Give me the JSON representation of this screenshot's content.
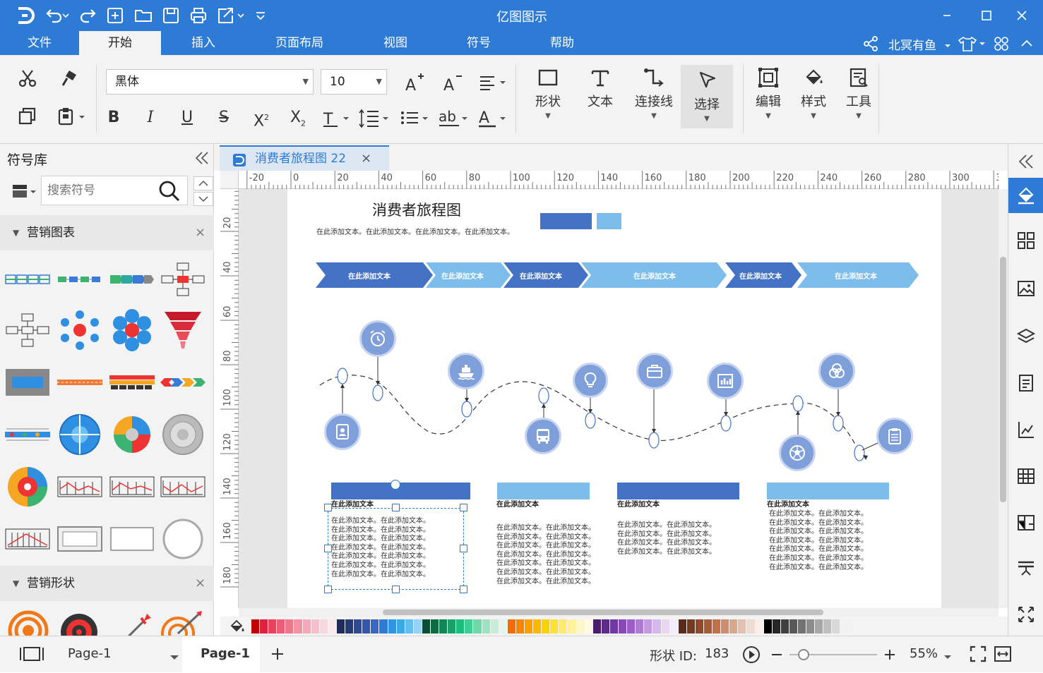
{
  "app": {
    "title": "亿图图示"
  },
  "menu": {
    "items": [
      "文件",
      "开始",
      "插入",
      "页面布局",
      "视图",
      "符号",
      "帮助"
    ],
    "active": "开始"
  },
  "user": {
    "name": "北冥有鱼"
  },
  "ribbon": {
    "font_family": "黑体",
    "font_size": "10",
    "groups": {
      "shape": "形状",
      "text": "文本",
      "connector": "连接线",
      "select": "选择",
      "edit": "编辑",
      "style": "样式",
      "tools": "工具"
    }
  },
  "library": {
    "title": "符号库",
    "search_placeholder": "搜索符号",
    "categories": [
      "营销图表",
      "营销形状"
    ]
  },
  "document": {
    "tab_title": "消费者旅程图 22"
  },
  "rulers": {
    "h_ticks": [
      "-20",
      "0",
      "20",
      "40",
      "60",
      "80",
      "100",
      "120",
      "140",
      "160",
      "180",
      "200",
      "220",
      "240",
      "260",
      "280",
      "300",
      "3"
    ],
    "v_ticks": [
      "20",
      "40",
      "60",
      "80",
      "100",
      "120",
      "140",
      "160",
      "180"
    ]
  },
  "diagram": {
    "title": "消费者旅程图",
    "subtitle": "在此添加文本。在此添加文本。在此添加文本。在此添加文本。",
    "arrow_label": "在此添加文本",
    "card_heading": "在此添加文本",
    "card_line": "在此添加文本。在此添加文本。",
    "colors": {
      "dark": "#4472c4",
      "light": "#7cbdec",
      "node": "#7e9fda"
    }
  },
  "status": {
    "page_selector": "Page-1",
    "current_page": "Page-1",
    "shape_id_label": "形状 ID:",
    "shape_id": "183",
    "zoom": "55%"
  },
  "palette_colors": [
    "#c00000",
    "#e0203f",
    "#e8425f",
    "#ec5d77",
    "#ef778d",
    "#f292a4",
    "#f4a8b8",
    "#f7c0cb",
    "#f9d7de",
    "#fbe9ed",
    "#1f2d5c",
    "#263a78",
    "#2e4995",
    "#3457ab",
    "#3867c2",
    "#2e7bd5",
    "#2f93e0",
    "#3ba8e8",
    "#63bdf0",
    "#94d3f6",
    "#0c4d33",
    "#0f6a44",
    "#138656",
    "#18a168",
    "#1bbd7d",
    "#3ecd92",
    "#6ed8a8",
    "#9be3c1",
    "#c6edd9",
    "#e6f6ed",
    "#f56d00",
    "#f78500",
    "#f99f00",
    "#fbb800",
    "#fdd000",
    "#fee133",
    "#feea6b",
    "#fef19c",
    "#fef6c6",
    "#fffae3",
    "#4b1e6c",
    "#5d2a86",
    "#7039a1",
    "#8649b6",
    "#9b5ec8",
    "#ae7bd4",
    "#c39ae0",
    "#d6b9ea",
    "#e8d6f3",
    "#f5ecf9",
    "#5a2b1a",
    "#743922",
    "#8f492b",
    "#a95b37",
    "#c27048",
    "#cd8c6b",
    "#d9a68e",
    "#e4c0b0",
    "#efdbd1",
    "#f8eee9",
    "#000000",
    "#262626",
    "#404040",
    "#595959",
    "#737373",
    "#8c8c8c",
    "#a6a6a6",
    "#bfbfbf",
    "#d9d9d9",
    "#f2f2f2"
  ]
}
